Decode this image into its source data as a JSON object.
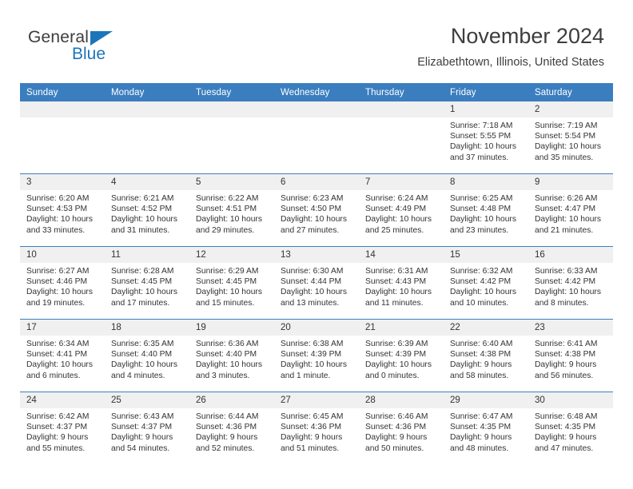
{
  "brand": {
    "name_top": "General",
    "name_bottom": "Blue",
    "triangle_color": "#1b75bb",
    "text_color": "#3d3d3d"
  },
  "header": {
    "title": "November 2024",
    "location": "Elizabethtown, Illinois, United States"
  },
  "theme": {
    "header_blue": "#3b7ebf",
    "daynum_gray": "#f0f0f0",
    "text": "#333333"
  },
  "weekdays": [
    "Sunday",
    "Monday",
    "Tuesday",
    "Wednesday",
    "Thursday",
    "Friday",
    "Saturday"
  ],
  "labels": {
    "sunrise_prefix": "Sunrise:",
    "sunset_prefix": "Sunset:",
    "daylight_prefix": "Daylight:"
  },
  "weeks": [
    [
      {
        "day": "",
        "empty": true
      },
      {
        "day": "",
        "empty": true
      },
      {
        "day": "",
        "empty": true
      },
      {
        "day": "",
        "empty": true
      },
      {
        "day": "",
        "empty": true
      },
      {
        "day": "1",
        "sunrise": "Sunrise: 7:18 AM",
        "sunset": "Sunset: 5:55 PM",
        "daylight_line1": "Daylight: 10 hours",
        "daylight_line2": "and 37 minutes."
      },
      {
        "day": "2",
        "sunrise": "Sunrise: 7:19 AM",
        "sunset": "Sunset: 5:54 PM",
        "daylight_line1": "Daylight: 10 hours",
        "daylight_line2": "and 35 minutes."
      }
    ],
    [
      {
        "day": "3",
        "sunrise": "Sunrise: 6:20 AM",
        "sunset": "Sunset: 4:53 PM",
        "daylight_line1": "Daylight: 10 hours",
        "daylight_line2": "and 33 minutes."
      },
      {
        "day": "4",
        "sunrise": "Sunrise: 6:21 AM",
        "sunset": "Sunset: 4:52 PM",
        "daylight_line1": "Daylight: 10 hours",
        "daylight_line2": "and 31 minutes."
      },
      {
        "day": "5",
        "sunrise": "Sunrise: 6:22 AM",
        "sunset": "Sunset: 4:51 PM",
        "daylight_line1": "Daylight: 10 hours",
        "daylight_line2": "and 29 minutes."
      },
      {
        "day": "6",
        "sunrise": "Sunrise: 6:23 AM",
        "sunset": "Sunset: 4:50 PM",
        "daylight_line1": "Daylight: 10 hours",
        "daylight_line2": "and 27 minutes."
      },
      {
        "day": "7",
        "sunrise": "Sunrise: 6:24 AM",
        "sunset": "Sunset: 4:49 PM",
        "daylight_line1": "Daylight: 10 hours",
        "daylight_line2": "and 25 minutes."
      },
      {
        "day": "8",
        "sunrise": "Sunrise: 6:25 AM",
        "sunset": "Sunset: 4:48 PM",
        "daylight_line1": "Daylight: 10 hours",
        "daylight_line2": "and 23 minutes."
      },
      {
        "day": "9",
        "sunrise": "Sunrise: 6:26 AM",
        "sunset": "Sunset: 4:47 PM",
        "daylight_line1": "Daylight: 10 hours",
        "daylight_line2": "and 21 minutes."
      }
    ],
    [
      {
        "day": "10",
        "sunrise": "Sunrise: 6:27 AM",
        "sunset": "Sunset: 4:46 PM",
        "daylight_line1": "Daylight: 10 hours",
        "daylight_line2": "and 19 minutes."
      },
      {
        "day": "11",
        "sunrise": "Sunrise: 6:28 AM",
        "sunset": "Sunset: 4:45 PM",
        "daylight_line1": "Daylight: 10 hours",
        "daylight_line2": "and 17 minutes."
      },
      {
        "day": "12",
        "sunrise": "Sunrise: 6:29 AM",
        "sunset": "Sunset: 4:45 PM",
        "daylight_line1": "Daylight: 10 hours",
        "daylight_line2": "and 15 minutes."
      },
      {
        "day": "13",
        "sunrise": "Sunrise: 6:30 AM",
        "sunset": "Sunset: 4:44 PM",
        "daylight_line1": "Daylight: 10 hours",
        "daylight_line2": "and 13 minutes."
      },
      {
        "day": "14",
        "sunrise": "Sunrise: 6:31 AM",
        "sunset": "Sunset: 4:43 PM",
        "daylight_line1": "Daylight: 10 hours",
        "daylight_line2": "and 11 minutes."
      },
      {
        "day": "15",
        "sunrise": "Sunrise: 6:32 AM",
        "sunset": "Sunset: 4:42 PM",
        "daylight_line1": "Daylight: 10 hours",
        "daylight_line2": "and 10 minutes."
      },
      {
        "day": "16",
        "sunrise": "Sunrise: 6:33 AM",
        "sunset": "Sunset: 4:42 PM",
        "daylight_line1": "Daylight: 10 hours",
        "daylight_line2": "and 8 minutes."
      }
    ],
    [
      {
        "day": "17",
        "sunrise": "Sunrise: 6:34 AM",
        "sunset": "Sunset: 4:41 PM",
        "daylight_line1": "Daylight: 10 hours",
        "daylight_line2": "and 6 minutes."
      },
      {
        "day": "18",
        "sunrise": "Sunrise: 6:35 AM",
        "sunset": "Sunset: 4:40 PM",
        "daylight_line1": "Daylight: 10 hours",
        "daylight_line2": "and 4 minutes."
      },
      {
        "day": "19",
        "sunrise": "Sunrise: 6:36 AM",
        "sunset": "Sunset: 4:40 PM",
        "daylight_line1": "Daylight: 10 hours",
        "daylight_line2": "and 3 minutes."
      },
      {
        "day": "20",
        "sunrise": "Sunrise: 6:38 AM",
        "sunset": "Sunset: 4:39 PM",
        "daylight_line1": "Daylight: 10 hours",
        "daylight_line2": "and 1 minute."
      },
      {
        "day": "21",
        "sunrise": "Sunrise: 6:39 AM",
        "sunset": "Sunset: 4:39 PM",
        "daylight_line1": "Daylight: 10 hours",
        "daylight_line2": "and 0 minutes."
      },
      {
        "day": "22",
        "sunrise": "Sunrise: 6:40 AM",
        "sunset": "Sunset: 4:38 PM",
        "daylight_line1": "Daylight: 9 hours",
        "daylight_line2": "and 58 minutes."
      },
      {
        "day": "23",
        "sunrise": "Sunrise: 6:41 AM",
        "sunset": "Sunset: 4:38 PM",
        "daylight_line1": "Daylight: 9 hours",
        "daylight_line2": "and 56 minutes."
      }
    ],
    [
      {
        "day": "24",
        "sunrise": "Sunrise: 6:42 AM",
        "sunset": "Sunset: 4:37 PM",
        "daylight_line1": "Daylight: 9 hours",
        "daylight_line2": "and 55 minutes."
      },
      {
        "day": "25",
        "sunrise": "Sunrise: 6:43 AM",
        "sunset": "Sunset: 4:37 PM",
        "daylight_line1": "Daylight: 9 hours",
        "daylight_line2": "and 54 minutes."
      },
      {
        "day": "26",
        "sunrise": "Sunrise: 6:44 AM",
        "sunset": "Sunset: 4:36 PM",
        "daylight_line1": "Daylight: 9 hours",
        "daylight_line2": "and 52 minutes."
      },
      {
        "day": "27",
        "sunrise": "Sunrise: 6:45 AM",
        "sunset": "Sunset: 4:36 PM",
        "daylight_line1": "Daylight: 9 hours",
        "daylight_line2": "and 51 minutes."
      },
      {
        "day": "28",
        "sunrise": "Sunrise: 6:46 AM",
        "sunset": "Sunset: 4:36 PM",
        "daylight_line1": "Daylight: 9 hours",
        "daylight_line2": "and 50 minutes."
      },
      {
        "day": "29",
        "sunrise": "Sunrise: 6:47 AM",
        "sunset": "Sunset: 4:35 PM",
        "daylight_line1": "Daylight: 9 hours",
        "daylight_line2": "and 48 minutes."
      },
      {
        "day": "30",
        "sunrise": "Sunrise: 6:48 AM",
        "sunset": "Sunset: 4:35 PM",
        "daylight_line1": "Daylight: 9 hours",
        "daylight_line2": "and 47 minutes."
      }
    ]
  ]
}
